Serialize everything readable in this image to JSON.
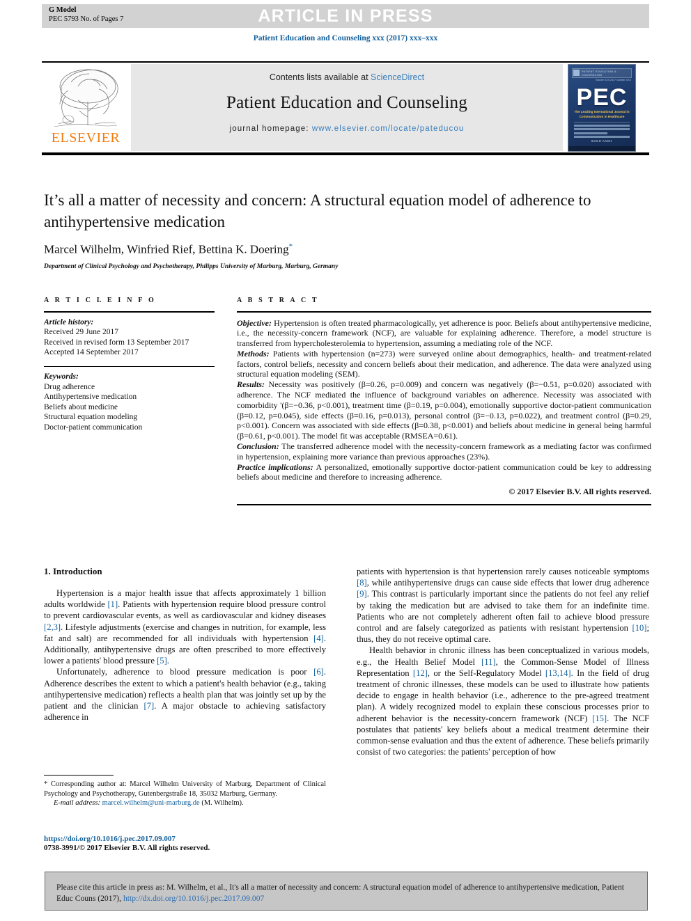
{
  "banner": {
    "g_model": "G Model",
    "pec_no": "PEC 5793 No. of Pages 7",
    "press_label": "ARTICLE IN PRESS"
  },
  "running_head": "Patient Education and Counseling xxx (2017) xxx–xxx",
  "masthead": {
    "contents_prefix": "Contents lists available at ",
    "sciencedirect": "ScienceDirect",
    "journal_name": "Patient Education and Counseling",
    "homepage_label": "journal homepage: ",
    "homepage_url": "www.elsevier.com/locate/pateducou",
    "publisher": "ELSEVIER",
    "cover": {
      "header_text": "PATIENT EDUCATION & COUNSELING",
      "issue_text": "Volume XXX 2017\nNumber XXX",
      "wordmark": "PEC",
      "tagline": "The Leading International Journal\nin Communication in Healthcare",
      "badge": "EACH   AACH"
    }
  },
  "article": {
    "title": "It’s all a matter of necessity and concern: A structural equation model of adherence to antihypertensive medication",
    "authors": "Marcel Wilhelm, Winfried Rief, Bettina K. Doering",
    "corresponding_marker": "*",
    "affiliation": "Department of Clinical Psychology and Psychotherapy, Philipps University of Marburg, Marburg, Germany"
  },
  "article_info": {
    "heading": "A R T I C L E   I N F O",
    "history_label": "Article history:",
    "history": [
      "Received 29 June 2017",
      "Received in revised form 13 September 2017",
      "Accepted 14 September 2017"
    ],
    "keywords_label": "Keywords:",
    "keywords": [
      "Drug adherence",
      "Antihypertensive medication",
      "Beliefs about medicine",
      "Structural equation modeling",
      "Doctor-patient communication"
    ]
  },
  "abstract": {
    "heading": "A B S T R A C T",
    "objective_label": "Objective:",
    "objective": " Hypertension is often treated pharmacologically, yet adherence is poor. Beliefs about antihypertensive medicine, i.e., the necessity-concern framework (NCF), are valuable for explaining adherence. Therefore, a model structure is transferred from hypercholesterolemia to hypertension, assuming a mediating role of the NCF.",
    "methods_label": "Methods:",
    "methods": " Patients with hypertension (n=273) were surveyed online about demographics, health- and treatment-related factors, control beliefs, necessity and concern beliefs about their medication, and adherence. The data were analyzed using structural equation modeling (SEM).",
    "results_label": "Results:",
    "results": " Necessity was positively (β=0.26, p=0.009) and concern was negatively (β=−0.51, p=0.020) associated with adherence. The NCF mediated the influence of background variables on adherence. Necessity was associated with comorbidity '(β=−0.36, p<0.001), treatment time (β=0.19, p=0.004), emotionally supportive doctor-patient communication (β=0.12, p=0.045), side effects (β=0.16, p=0.013), personal control (β=−0.13, p=0.022), and treatment control (β=0.29, p<0.001). Concern was associated with side effects (β=0.38, p<0.001) and beliefs about medicine in general being harmful (β=0.61, p<0.001). The model fit was acceptable (RMSEA=0.61).",
    "conclusion_label": "Conclusion:",
    "conclusion": " The transferred adherence model with the necessity-concern framework as a mediating factor was confirmed in hypertension, explaining more variance than previous approaches (23%).",
    "implications_label": "Practice implications:",
    "implications": " A personalized, emotionally supportive doctor-patient communication could be key to addressing beliefs about medicine and therefore to increasing adherence.",
    "copyright": "© 2017 Elsevier B.V. All rights reserved."
  },
  "introduction": {
    "heading": "1. Introduction",
    "left_paragraphs": [
      "Hypertension is a major health issue that affects approximately 1 billion adults worldwide [1]. Patients with hypertension require blood pressure control to prevent cardiovascular events, as well as cardiovascular and kidney diseases [2,3]. Lifestyle adjustments (exercise and changes in nutrition, for example, less fat and salt) are recommended for all individuals with hypertension [4]. Additionally, antihypertensive drugs are often prescribed to more effectively lower a patients' blood pressure [5].",
      "Unfortunately, adherence to blood pressure medication is poor [6]. Adherence describes the extent to which a patient's health behavior (e.g., taking antihypertensive medication) reflects a health plan that was jointly set up by the patient and the clinician [7]. A major obstacle to achieving satisfactory adherence in"
    ],
    "right_paragraphs": [
      "patients with hypertension is that hypertension rarely causes noticeable symptoms [8], while antihypertensive drugs can cause side effects that lower drug adherence [9]. This contrast is particularly important since the patients do not feel any relief by taking the medication but are advised to take them for an indefinite time. Patients who are not completely adherent often fail to achieve blood pressure control and are falsely categorized as patients with resistant hypertension [10]; thus, they do not receive optimal care.",
      "Health behavior in chronic illness has been conceptualized in various models, e.g., the Health Belief Model [11], the Common-Sense Model of Illness Representation [12], or the Self-Regulatory Model [13,14]. In the field of drug treatment of chronic illnesses, these models can be used to illustrate how patients decide to engage in health behavior (i.e., adherence to the pre-agreed treatment plan). A widely recognized model to explain these conscious processes prior to adherent behavior is the necessity-concern framework (NCF) [15]. The NCF postulates that patients' key beliefs about a medical treatment determine their common-sense evaluation and thus the extent of adherence. These beliefs primarily consist of two categories: the patients' perception of how"
    ]
  },
  "footnote": {
    "text": "* Corresponding author at: Marcel Wilhelm University of Marburg, Department of Clinical Psychology and Psychotherapy, Gutenbergstraße 18, 35032 Marburg, Germany.",
    "email_label": "E-mail address:",
    "email": "marcel.wilhelm@uni-marburg.de",
    "email_suffix": " (M. Wilhelm)."
  },
  "doi_block": {
    "doi": "https://doi.org/10.1016/j.pec.2017.09.007",
    "issn": "0738-3991/© 2017 Elsevier B.V. All rights reserved."
  },
  "cite_box": {
    "text": "Please cite this article in press as: M. Wilhelm, et al., It's all a matter of necessity and concern: A structural equation model of adherence to antihypertensive medication, Patient Educ Couns (2017), ",
    "link": "http://dx.doi.org/10.1016/j.pec.2017.09.007"
  },
  "colors": {
    "link_blue": "#14609b",
    "sd_blue": "#3a7fbd",
    "elsevier_orange": "#f07e13",
    "banner_gray": "#d2d2d2",
    "panel_gray": "#e7e7e7",
    "cite_gray": "#c6c6c6"
  }
}
